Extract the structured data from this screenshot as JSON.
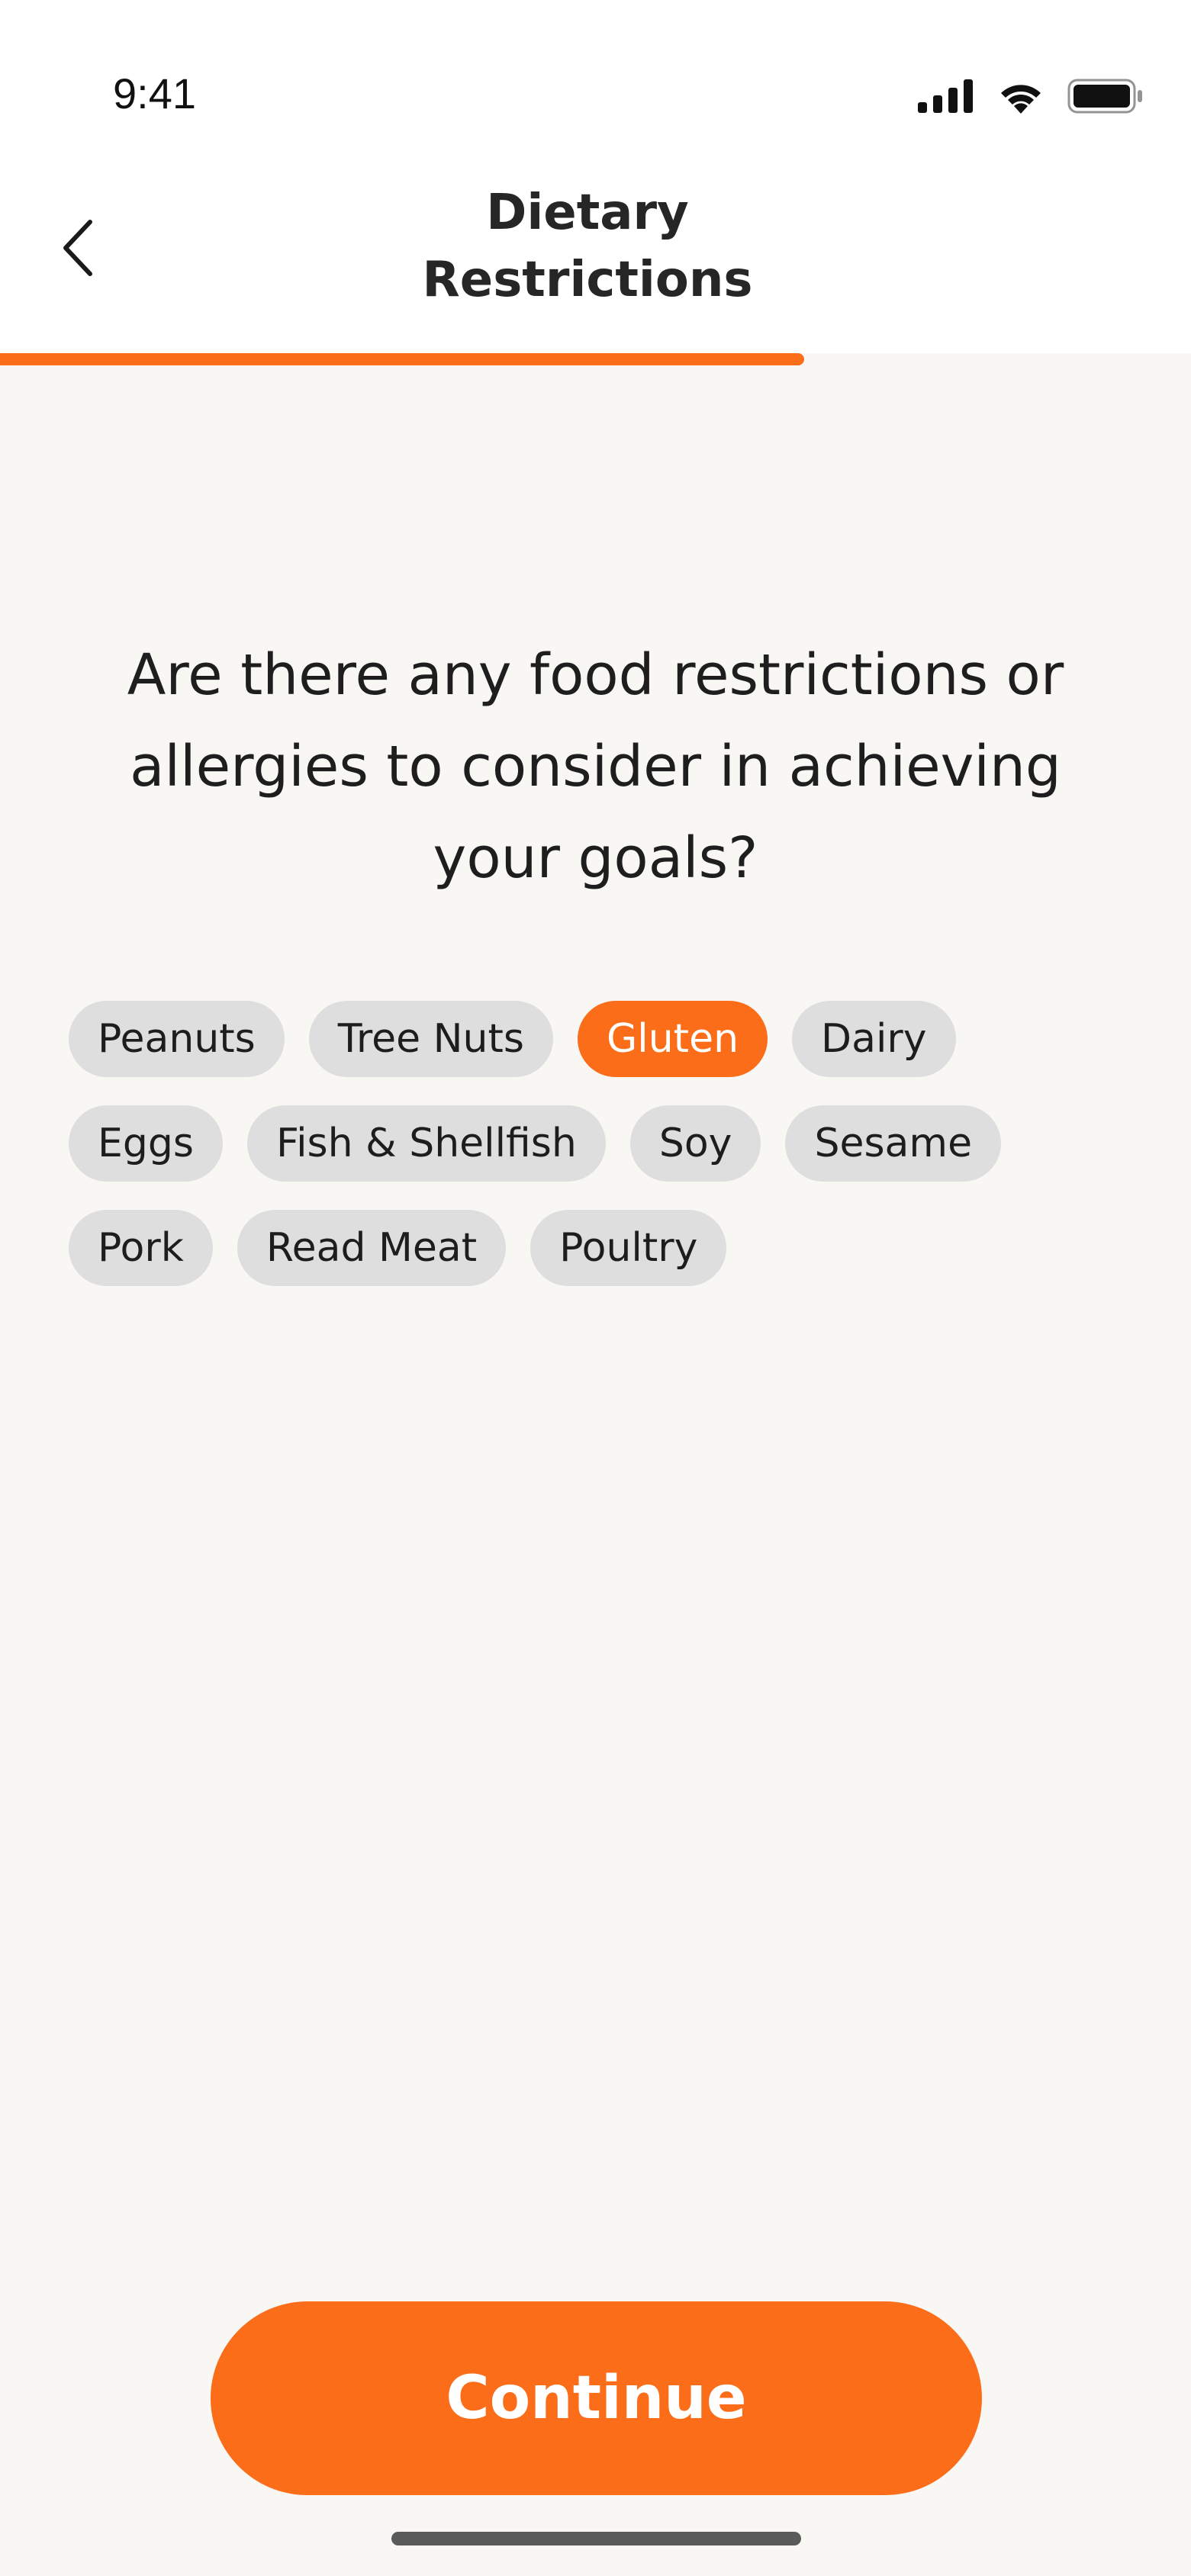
{
  "status_bar": {
    "time": "9:41",
    "icons": [
      "cellular-signal-icon",
      "wifi-icon",
      "battery-icon"
    ]
  },
  "header": {
    "back_icon": "chevron-left-icon",
    "title_line1": "Dietary",
    "title_line2": "Restrictions"
  },
  "progress": {
    "fraction": 0.675,
    "color": "#fb6d18"
  },
  "question": "Are there any food restrictions or allergies to consider in achieving your goals?",
  "options": [
    {
      "label": "Peanuts",
      "selected": false
    },
    {
      "label": "Tree Nuts",
      "selected": false
    },
    {
      "label": "Gluten",
      "selected": true
    },
    {
      "label": "Dairy",
      "selected": false
    },
    {
      "label": "Eggs",
      "selected": false
    },
    {
      "label": "Fish & Shellfish",
      "selected": false
    },
    {
      "label": "Soy",
      "selected": false
    },
    {
      "label": "Sesame",
      "selected": false
    },
    {
      "label": "Pork",
      "selected": false
    },
    {
      "label": "Read Meat",
      "selected": false
    },
    {
      "label": "Poultry",
      "selected": false
    }
  ],
  "continue_label": "Continue",
  "colors": {
    "accent": "#fb6d18",
    "chip_background": "#dedede",
    "page_background": "#f8f7f4"
  }
}
